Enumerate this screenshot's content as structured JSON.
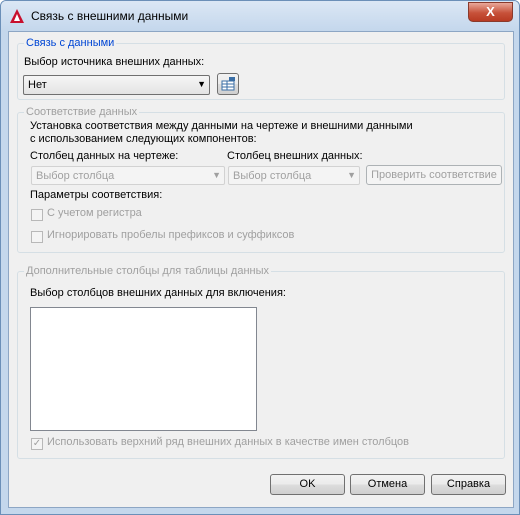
{
  "window": {
    "title": "Связь с внешними данными",
    "close_glyph": "X"
  },
  "data_link": {
    "group_title": "Связь с данными",
    "source_label": "Выбор источника внешних данных:",
    "source_value": "Нет",
    "accent_color": "#0046d5"
  },
  "data_match": {
    "group_title": "Соответствие данных",
    "description_line1": "Установка соответствия между данными на чертеже и внешними данными",
    "description_line2": "с использованием следующих компонентов:",
    "drawing_column_label": "Столбец данных на чертеже:",
    "drawing_column_value": "Выбор столбца",
    "external_column_label": "Столбец внешних данных:",
    "external_column_value": "Выбор столбца",
    "check_button": "Проверить соответствие",
    "params_label": "Параметры соответствия:",
    "case_sensitive": "С учетом регистра",
    "ignore_spaces": "Игнорировать пробелы префиксов и суффиксов"
  },
  "extra_columns": {
    "group_title": "Дополнительные столбцы для таблицы данных",
    "select_label": "Выбор столбцов внешних данных для включения:",
    "use_header": "Использовать верхний ряд внешних данных в качестве имен столбцов",
    "use_header_checked": true
  },
  "buttons": {
    "ok": "OK",
    "cancel": "Отмена",
    "help": "Справка"
  }
}
